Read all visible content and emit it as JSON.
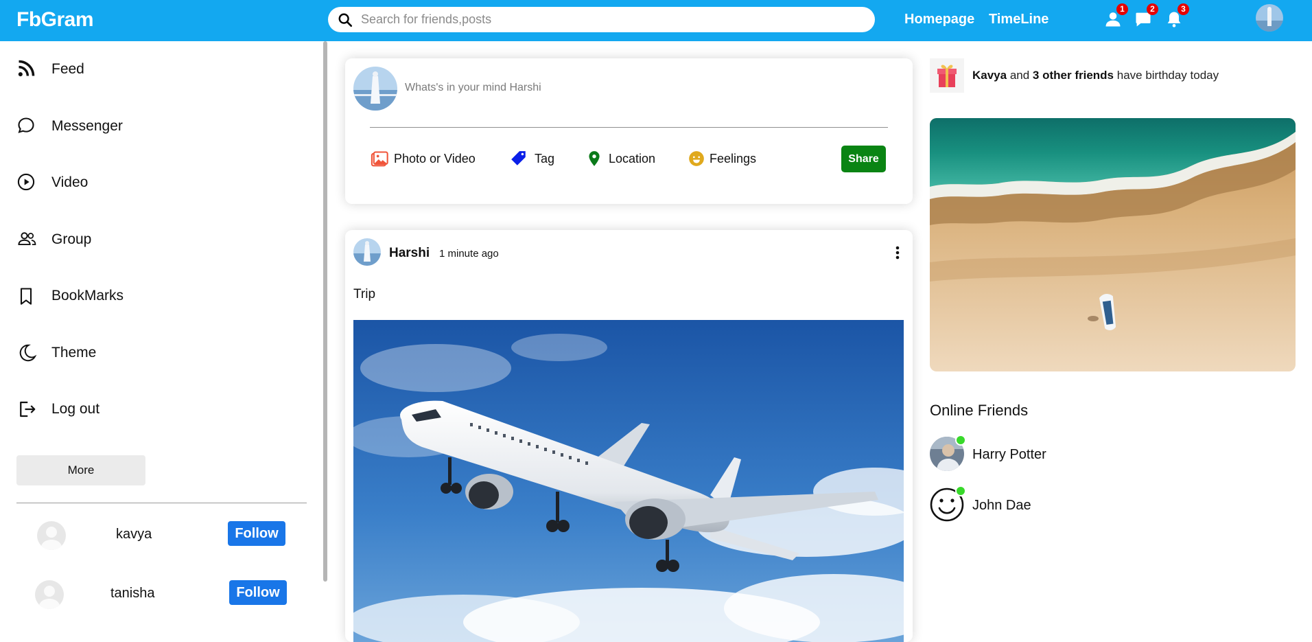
{
  "topbar": {
    "logo": "FbGram",
    "search_placeholder": "Search for friends,posts",
    "links": [
      "Homepage",
      "TimeLine"
    ],
    "icons": [
      {
        "name": "person-icon",
        "badge": "1"
      },
      {
        "name": "chat-icon",
        "badge": "2"
      },
      {
        "name": "bell-icon",
        "badge": "3"
      }
    ]
  },
  "sidebar": {
    "items": [
      {
        "label": "Feed",
        "icon": "rss-icon"
      },
      {
        "label": "Messenger",
        "icon": "chat-bubble-icon"
      },
      {
        "label": "Video",
        "icon": "play-circle-icon"
      },
      {
        "label": "Group",
        "icon": "group-icon"
      },
      {
        "label": "BookMarks",
        "icon": "bookmark-icon"
      },
      {
        "label": "Theme",
        "icon": "moon-icon"
      },
      {
        "label": "Log out",
        "icon": "logout-icon"
      }
    ],
    "more_label": "More",
    "suggestions": [
      {
        "name": "kavya",
        "button": "Follow"
      },
      {
        "name": "tanisha",
        "button": "Follow"
      }
    ]
  },
  "share": {
    "placeholder": "Whats's in your mind Harshi",
    "options": [
      {
        "label": "Photo or Video",
        "icon": "photo-icon",
        "color": "#f0553a"
      },
      {
        "label": "Tag",
        "icon": "tag-icon",
        "color": "#0a1fe8"
      },
      {
        "label": "Location",
        "icon": "location-pin-icon",
        "color": "#0b7a1a"
      },
      {
        "label": "Feelings",
        "icon": "smiley-icon",
        "color": "#e0a91d"
      }
    ],
    "share_label": "Share"
  },
  "post": {
    "username": "Harshi",
    "time": "1 minute ago",
    "text": "Trip"
  },
  "rightbar": {
    "birthday": {
      "name": "Kavya",
      "middle": " and ",
      "others": "3 other friends",
      "tail": " have birthday today"
    },
    "online_title": "Online Friends",
    "online": [
      {
        "name": "Harry Potter"
      },
      {
        "name": "John Dae"
      }
    ]
  },
  "colors": {
    "topbar": "#13a8f0",
    "follow": "#1976e8",
    "share": "#0a8413",
    "badge": "#e60000",
    "online": "#38d92b"
  }
}
